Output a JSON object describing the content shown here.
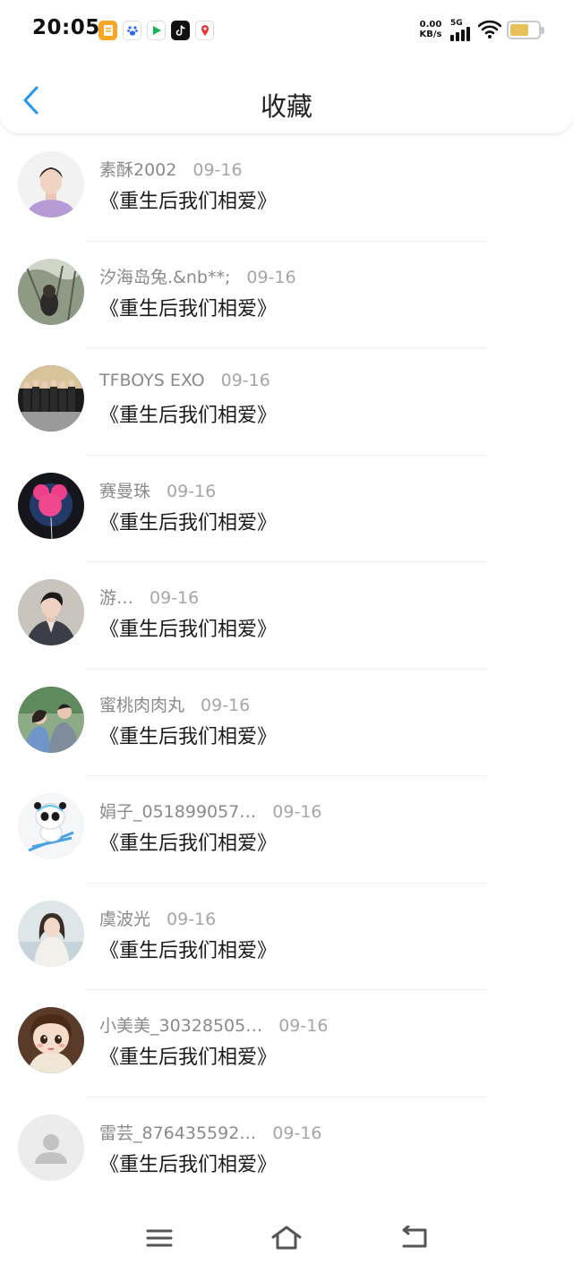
{
  "status_bar": {
    "time": "20:05",
    "app_icons": [
      "notes-icon",
      "baidu-icon",
      "video-play-icon",
      "tiktok-icon",
      "map-pin-icon"
    ],
    "net_speed_value": "0.00",
    "net_speed_unit": "KB/s",
    "network_type": "5G",
    "battery_color": "#e8c05a"
  },
  "header": {
    "title": "收藏",
    "back_icon": "chevron-left-icon",
    "accent_color": "#2196f3"
  },
  "items": [
    {
      "user": "素酥2002",
      "date": "09-16",
      "title": "《重生后我们相爱》",
      "avatar": "avatar-photo"
    },
    {
      "user": "汐海岛兔.&nb**;",
      "date": "09-16",
      "title": "《重生后我们相爱》",
      "avatar": "avatar-photo"
    },
    {
      "user": "TFBOYS EXO",
      "date": "09-16",
      "title": "《重生后我们相爱》",
      "avatar": "avatar-photo"
    },
    {
      "user": "赛曼珠",
      "date": "09-16",
      "title": "《重生后我们相爱》",
      "avatar": "avatar-photo"
    },
    {
      "user": "游…",
      "date": "09-16",
      "title": "《重生后我们相爱》",
      "avatar": "avatar-photo"
    },
    {
      "user": "蜜桃肉肉丸",
      "date": "09-16",
      "title": "《重生后我们相爱》",
      "avatar": "avatar-photo"
    },
    {
      "user": "娟子_051899057…",
      "date": "09-16",
      "title": "《重生后我们相爱》",
      "avatar": "avatar-photo"
    },
    {
      "user": "虞波光",
      "date": "09-16",
      "title": "《重生后我们相爱》",
      "avatar": "avatar-photo"
    },
    {
      "user": "小美美_30328505…",
      "date": "09-16",
      "title": "《重生后我们相爱》",
      "avatar": "avatar-photo"
    },
    {
      "user": "雷芸_876435592…",
      "date": "09-16",
      "title": "《重生后我们相爱》",
      "avatar": "default-avatar-icon"
    }
  ],
  "nav_bar": {
    "buttons": [
      "menu-icon",
      "home-icon",
      "back-icon"
    ]
  }
}
